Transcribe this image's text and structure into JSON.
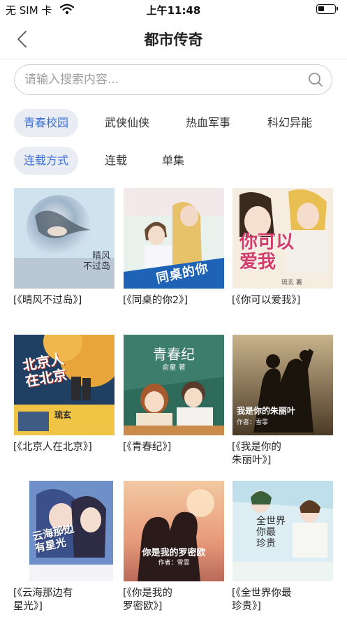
{
  "status_bar": {
    "carrier": "无 SIM 卡",
    "time": "上午11:48"
  },
  "nav": {
    "title": "都市传奇"
  },
  "search": {
    "placeholder": "请输入搜索内容..."
  },
  "genre_tabs": [
    "青春校园",
    "武侠仙侠",
    "热血军事",
    "科幻异能"
  ],
  "mode_tabs": [
    "连载方式",
    "连载",
    "单集"
  ],
  "books": [
    {
      "caption": "[《晴风不过岛》]",
      "cover_text": "晴风\n不过岛"
    },
    {
      "caption": "[《同桌的你2》]",
      "cover_text": "同桌的你"
    },
    {
      "caption": "[《你可以爱我》]",
      "cover_text": "你可以\n爱我",
      "cover_author": "琉玄 著"
    },
    {
      "caption": "[《北京人在北京》]",
      "cover_text": "北京人\n在北京",
      "cover_author": "琉玄"
    },
    {
      "caption": "[《青春纪》]",
      "cover_text": "青春纪",
      "cover_author": "俞童 著"
    },
    {
      "caption": "[《我是你的\n朱丽叶》]",
      "cover_text": "我是你的朱丽叶",
      "cover_author": "作者：雪霏"
    },
    {
      "caption": "[《云海那边有\n星光》]",
      "cover_text": "云海那边\n有星光"
    },
    {
      "caption": "[《你是我的\n罗密欧》]",
      "cover_text": "你是我的罗密欧",
      "cover_author": "作者：雪霏"
    },
    {
      "caption": "[《全世界你最\n珍贵》]",
      "cover_text": "全世界\n你最\n珍贵"
    }
  ]
}
